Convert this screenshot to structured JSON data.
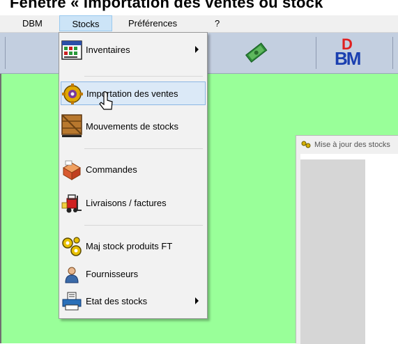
{
  "banner": {
    "text": "Fenêtre « Importation des ventes ou stock"
  },
  "menubar": {
    "items": [
      {
        "label": "DBM"
      },
      {
        "label": "Stocks"
      },
      {
        "label": "Préférences"
      },
      {
        "label": "?"
      }
    ]
  },
  "stocks_menu": {
    "items": [
      {
        "label": "Inventaires",
        "icon": "inventory-icon",
        "submenu": true
      },
      {
        "label": "Importation des ventes",
        "icon": "gear-import-icon",
        "submenu": false,
        "highlighted": true
      },
      {
        "label": "Mouvements de stocks",
        "icon": "crate-icon",
        "submenu": false
      },
      {
        "label": "Commandes",
        "icon": "order-box-icon",
        "submenu": false
      },
      {
        "label": "Livraisons / factures",
        "icon": "forklift-icon",
        "submenu": false
      },
      {
        "label": "Maj stock produits FT",
        "icon": "gears-icon",
        "submenu": false
      },
      {
        "label": "Fournisseurs",
        "icon": "person-icon",
        "submenu": false
      },
      {
        "label": "Etat des stocks",
        "icon": "printer-icon",
        "submenu": true
      }
    ]
  },
  "child_window": {
    "title": "Mise à jour des stocks"
  },
  "toolbar": {
    "logo_text": "BM",
    "logo_accent": "D"
  },
  "colors": {
    "workspace": "#99ff99",
    "toolbar": "#c3cfe0",
    "menu_highlight": "#dbe9f7"
  }
}
